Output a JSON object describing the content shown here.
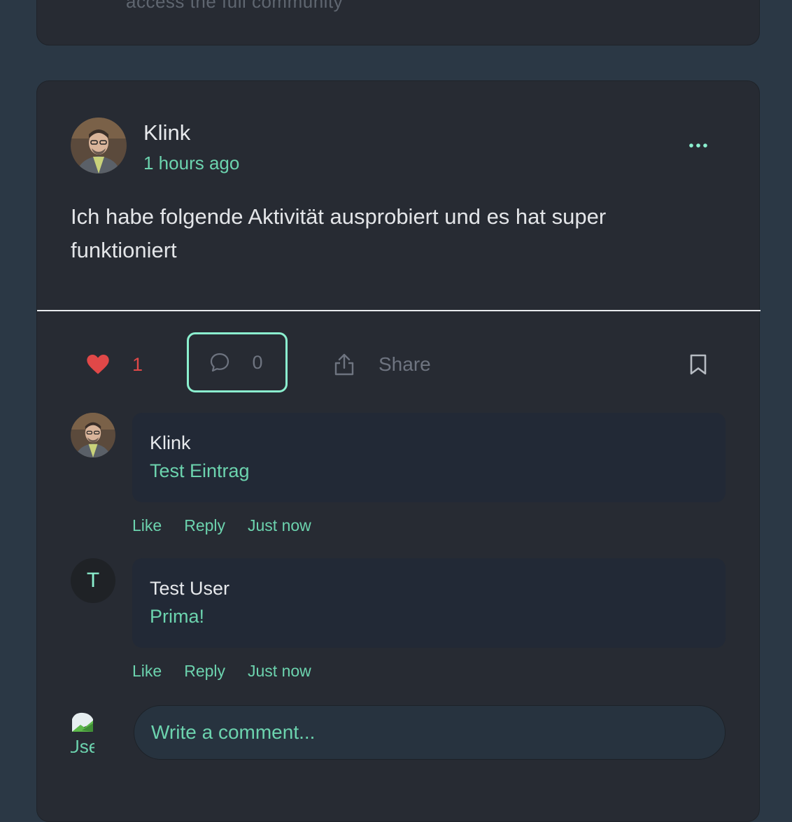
{
  "previous_post": {
    "faded_text": "access the full community"
  },
  "post": {
    "author": "Klink",
    "time": "1 hours ago",
    "body": "Ich habe folgende Aktivität ausprobiert und es hat super funktioniert",
    "likes": "1",
    "comments_count": "0",
    "share_label": "Share"
  },
  "comments": [
    {
      "author": "Klink",
      "text": "Test Eintrag",
      "like_label": "Like",
      "reply_label": "Reply",
      "time": "Just now"
    },
    {
      "author": "Test User",
      "avatar_letter": "T",
      "text": "Prima!",
      "like_label": "Like",
      "reply_label": "Reply",
      "time": "Just now"
    }
  ],
  "composer": {
    "placeholder": "Write a comment...",
    "avatar_alt": "User"
  },
  "colors": {
    "accent": "#6cd3ae",
    "like": "#e04848",
    "background": "#2b3845",
    "card": "#272b33"
  },
  "icons": {
    "more": "more-dots-icon",
    "like": "heart-icon",
    "comment": "comment-bubble-icon",
    "share": "share-icon",
    "bookmark": "bookmark-icon"
  }
}
